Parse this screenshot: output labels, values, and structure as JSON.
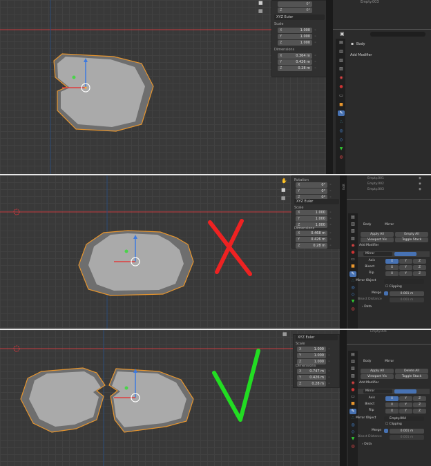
{
  "panel1": {
    "rotation_y": "0°",
    "rotation_z": "0°",
    "euler_mode": "XYZ Euler",
    "scale_label": "Scale",
    "scale": [
      {
        "axis": "X",
        "value": "1.000"
      },
      {
        "axis": "Y",
        "value": "1.000"
      },
      {
        "axis": "Z",
        "value": "1.000"
      }
    ],
    "dimensions_label": "Dimensions",
    "dimensions": [
      {
        "axis": "X",
        "value": "0.364 m"
      },
      {
        "axis": "Y",
        "value": "0.426 m"
      },
      {
        "axis": "Z",
        "value": "0.28 m"
      }
    ],
    "outliner_item": "Empty.003",
    "object_name": "Body",
    "add_modifier": "Add Modifier"
  },
  "panel2": {
    "rotation_label": "Rotation",
    "rotation": [
      {
        "axis": "X",
        "value": "0°"
      },
      {
        "axis": "Y",
        "value": "0°"
      },
      {
        "axis": "Z",
        "value": "0°"
      }
    ],
    "euler_mode": "XYZ Euler",
    "scale_label": "Scale",
    "scale": [
      {
        "axis": "X",
        "value": "1.000"
      },
      {
        "axis": "Y",
        "value": "1.000"
      },
      {
        "axis": "Z",
        "value": "1.000"
      }
    ],
    "dimensions_label": "Dimensions",
    "dimensions": [
      {
        "axis": "X",
        "value": "0.468 m"
      },
      {
        "axis": "Y",
        "value": "0.426 m"
      },
      {
        "axis": "Z",
        "value": "0.28 m"
      }
    ],
    "outliner_items": [
      "Empty.001",
      "Empty.002",
      "Empty.003"
    ],
    "breadcrumb_object": "Body",
    "breadcrumb_modifier": "Mirror",
    "apply_all": "Apply All",
    "delete_all": "Empty All",
    "viewport_vis": "Viewport Vis",
    "toggle_stack": "Toggle Stack",
    "add_modifier": "Add Modifier",
    "modifier_name": "Mirror",
    "axis_label": "Axis",
    "bisect_label": "Bisect",
    "flip_label": "Flip",
    "axes": [
      "X",
      "Y",
      "Z"
    ],
    "mirror_object_label": "Mirror Object",
    "mirror_object_value": "",
    "clipping_label": "Clipping",
    "merge_label": "Merge",
    "merge_value": "0.001 m",
    "bisect_distance_label": "Bisect Distance",
    "bisect_distance_value": "0.001 m",
    "data_label": "Data",
    "side_label": "Edit"
  },
  "panel3": {
    "euler_mode": "XYZ Euler",
    "scale_label": "Scale",
    "scale": [
      {
        "axis": "X",
        "value": "1.000"
      },
      {
        "axis": "Y",
        "value": "1.000"
      },
      {
        "axis": "Z",
        "value": "1.000"
      }
    ],
    "dimensions_label": "Dimensions",
    "dimensions": [
      {
        "axis": "X",
        "value": "0.747 m"
      },
      {
        "axis": "Y",
        "value": "0.426 m"
      },
      {
        "axis": "Z",
        "value": "0.28 m"
      }
    ],
    "outliner_item": "Empty.004",
    "breadcrumb_object": "Body",
    "breadcrumb_modifier": "Mirror",
    "apply_all": "Apply All",
    "delete_all": "Delete All",
    "viewport_vis": "Viewport Vis",
    "toggle_stack": "Toggle Stack",
    "add_modifier": "Add Modifier",
    "modifier_name": "Mirror",
    "axis_label": "Axis",
    "bisect_label": "Bisect",
    "flip_label": "Flip",
    "axes": [
      "X",
      "Y",
      "Z"
    ],
    "mirror_object_label": "Mirror Object",
    "mirror_object_value": "Empty.004",
    "clipping_label": "Clipping",
    "merge_label": "Merge",
    "merge_value": "0.001 m",
    "bisect_distance_label": "Bisect Distance",
    "bisect_distance_value": "0.001 m",
    "data_label": "Data"
  },
  "colors": {
    "outline": "#e8962e",
    "mesh": "#aaaaaa",
    "mesh_shadow": "#6e6e6e",
    "x_axis": "#d9383f",
    "y_axis": "#2e4a73",
    "wrong_mark": "#ee2222",
    "right_mark": "#22dd22",
    "gizmo_z": "#3d7ae0",
    "gizmo_x": "#e03d3d",
    "gizmo_y": "#4bd34b"
  },
  "icons": [
    "hand-icon",
    "camera-icon",
    "grid-icon",
    "wrench-icon",
    "search-icon",
    "modifier-icon"
  ]
}
